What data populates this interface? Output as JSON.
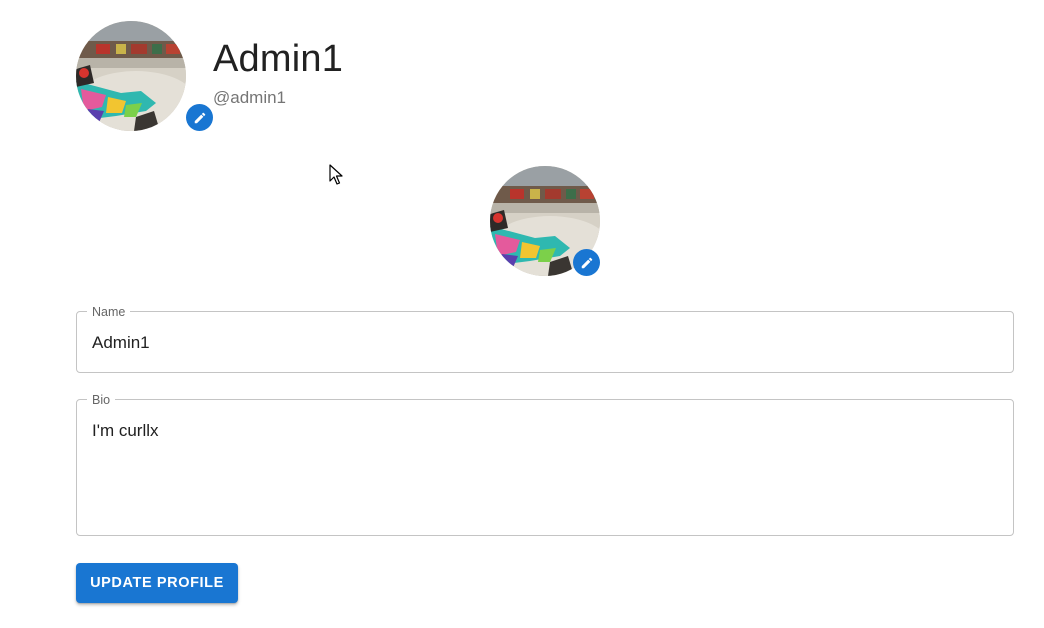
{
  "profile": {
    "display_name": "Admin1",
    "handle": "@admin1",
    "avatar_icon": "profile-photo-rifle-skin",
    "edit_icon": "pencil-icon"
  },
  "form": {
    "name_label": "Name",
    "name_value": "Admin1",
    "bio_label": "Bio",
    "bio_value": "I'm curllx",
    "submit_label": "UPDATE PROFILE"
  },
  "colors": {
    "accent": "#1976d2",
    "field_border": "#c4c4c4",
    "muted_text": "#757575"
  }
}
